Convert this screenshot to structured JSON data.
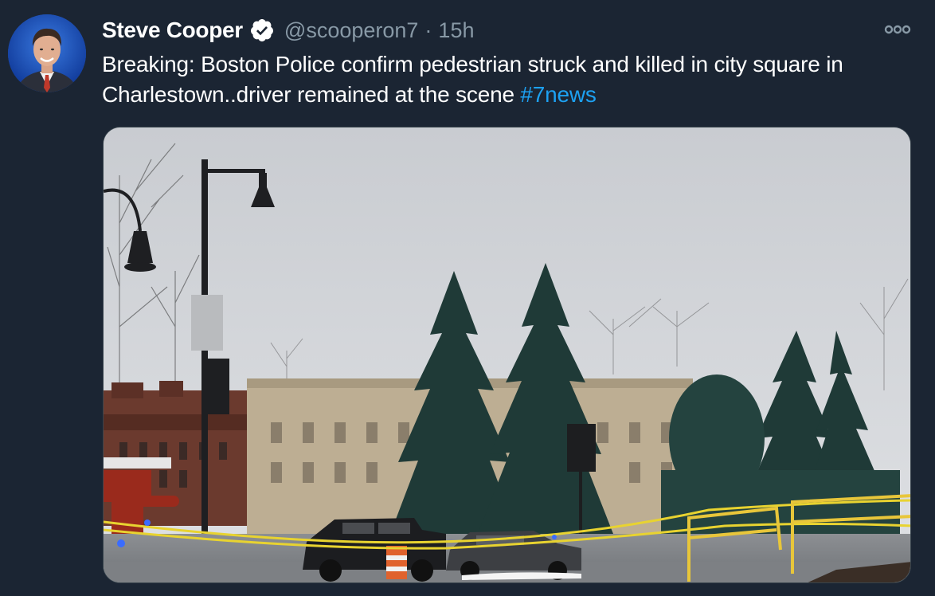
{
  "tweet": {
    "author_name": "Steve Cooper",
    "handle": "@scooperon7",
    "separator": "·",
    "timestamp": "15h",
    "text": "Breaking: Boston Police confirm pedestrian struck and killed in city square in Charlestown..driver remained at the scene ",
    "hashtag": "#7news",
    "verified": true
  },
  "icons": {
    "verified": "verified-badge-icon",
    "more": "more-options-icon"
  },
  "colors": {
    "background": "#1b2533",
    "text": "#ffffff",
    "secondary_text": "#8899a6",
    "link": "#1da1f2"
  }
}
